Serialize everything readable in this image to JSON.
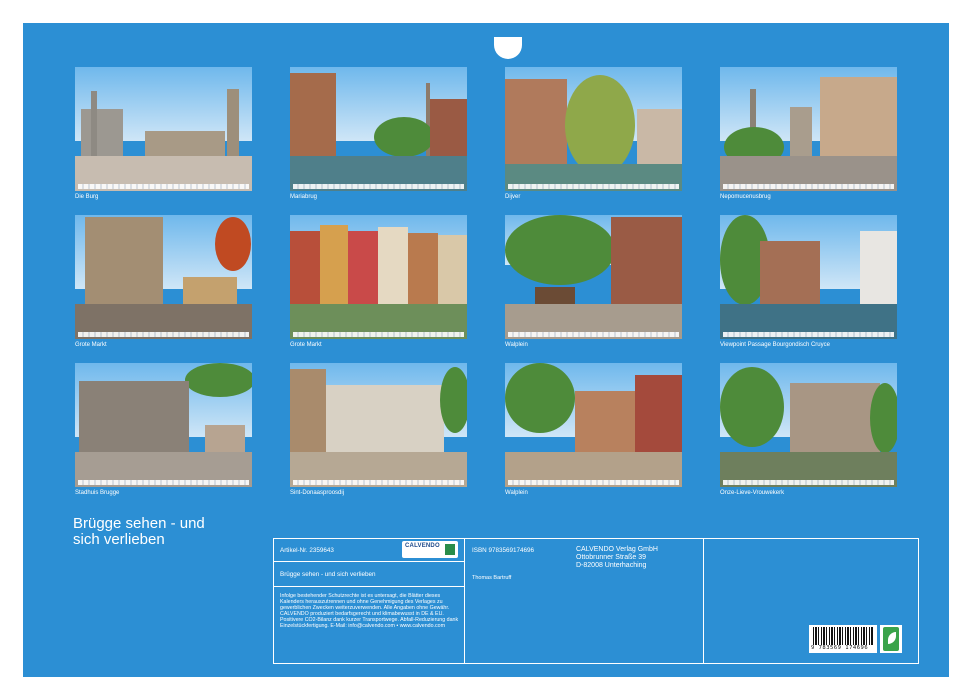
{
  "calendar": {
    "title_line1": "Brügge sehen - und",
    "title_line2": "sich verlieben"
  },
  "photos": [
    {
      "caption": "Die Burg"
    },
    {
      "caption": "Mariabrug"
    },
    {
      "caption": "Dijver"
    },
    {
      "caption": "Nepomucenusbrug"
    },
    {
      "caption": "Grote Markt"
    },
    {
      "caption": "Grote Markt"
    },
    {
      "caption": "Walplein"
    },
    {
      "caption": "Viewpoint Passage Bourgondisch Cruyce"
    },
    {
      "caption": "Stadhuis Brugge"
    },
    {
      "caption": "Sint-Donaasproosdij"
    },
    {
      "caption": "Walplein"
    },
    {
      "caption": "Onze-Lieve-Vrouwekerk"
    }
  ],
  "info": {
    "article": "Artikel-Nr. 2359643",
    "calendar_name": "Brügge sehen - und sich verlieben",
    "isbn": "ISBN 9783569174696",
    "author": "Thomas Bartruff",
    "publisher_name": "CALVENDO Verlag GmbH",
    "publisher_street": "Ottobrunner Straße 39",
    "publisher_city": "D-82008 Unterhaching",
    "legal_text": "Infolge bestehender Schutzrechte ist es untersagt, die Blätter dieses Kalenders herauszutrennen und ohne Genehmigung des Verlages zu gewerblichen Zwecken weiterzuverwenden. Alle Angaben ohne Gewähr. CALVENDO produziert bedarfsgerecht und klimabewusst in DE & EU. Positivere CO2-Bilanz dank kurzer Transportwege. Abfall-Reduzierung dank Einzelstückfertigung. E-Mail: info@calvendo.com • www.calvendo.com",
    "logo_text": "CALVENDO",
    "barcode_number": "9 783569 174696"
  },
  "colors": {
    "background_blue": "#2c8fd4",
    "logo_green": "#2a8d4a"
  }
}
